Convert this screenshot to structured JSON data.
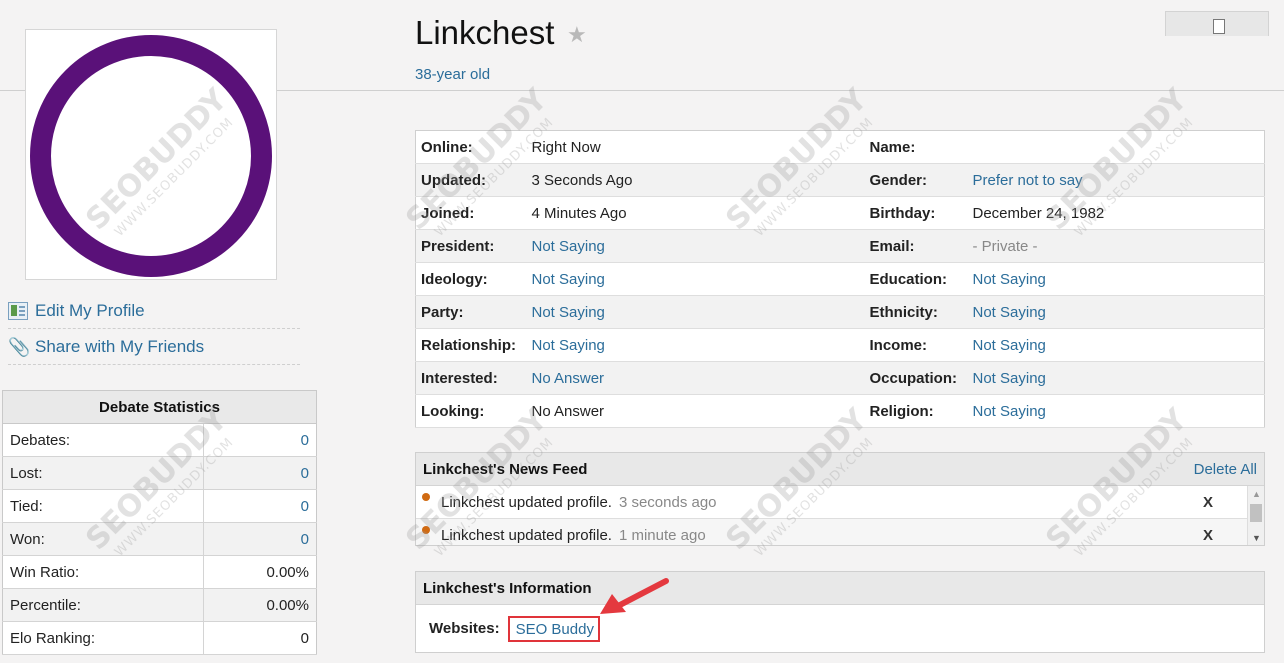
{
  "profile": {
    "username": "Linkchest",
    "age": "38-year old"
  },
  "sidebar": {
    "edit_profile": "Edit My Profile",
    "share": "Share with My Friends"
  },
  "debate_stats": {
    "title": "Debate Statistics",
    "rows": [
      {
        "label": "Debates:",
        "value": "0"
      },
      {
        "label": "Lost:",
        "value": "0"
      },
      {
        "label": "Tied:",
        "value": "0"
      },
      {
        "label": "Won:",
        "value": "0"
      },
      {
        "label": "Win Ratio:",
        "value": "0.00%"
      },
      {
        "label": "Percentile:",
        "value": "0.00%"
      },
      {
        "label": "Elo Ranking:",
        "value": "0"
      }
    ]
  },
  "info": {
    "rows": [
      {
        "l1": "Online:",
        "v1": "Right Now",
        "l2": "Name:",
        "v2": ""
      },
      {
        "l1": "Updated:",
        "v1": "3 Seconds Ago",
        "l2": "Gender:",
        "v2": "Prefer not to say"
      },
      {
        "l1": "Joined:",
        "v1": "4 Minutes Ago",
        "l2": "Birthday:",
        "v2": "December 24, 1982"
      },
      {
        "l1": "President:",
        "v1": "Not Saying",
        "l2": "Email:",
        "v2": "- Private -"
      },
      {
        "l1": "Ideology:",
        "v1": "Not Saying",
        "l2": "Education:",
        "v2": "Not Saying"
      },
      {
        "l1": "Party:",
        "v1": "Not Saying",
        "l2": "Ethnicity:",
        "v2": "Not Saying"
      },
      {
        "l1": "Relationship:",
        "v1": "Not Saying",
        "l2": "Income:",
        "v2": "Not Saying"
      },
      {
        "l1": "Interested:",
        "v1": "No Answer",
        "l2": "Occupation:",
        "v2": "Not Saying"
      },
      {
        "l1": "Looking:",
        "v1": "No Answer",
        "l2": "Religion:",
        "v2": "Not Saying"
      }
    ]
  },
  "news_feed": {
    "title": "Linkchest's News Feed",
    "delete_all": "Delete All",
    "items": [
      {
        "text": "Linkchest updated profile.",
        "time": "3 seconds ago",
        "remove": "X"
      },
      {
        "text": "Linkchest updated profile.",
        "time": "1 minute ago",
        "remove": "X"
      }
    ]
  },
  "information": {
    "title": "Linkchest's Information",
    "websites_label": "Websites:",
    "website": "SEO Buddy"
  },
  "watermark": {
    "brand": "SEOBUDDY",
    "url": "WWW.SEOBUDDY.COM"
  },
  "colors": {
    "link": "#2b6d9a",
    "avatar_ring": "#5a1179",
    "highlight": "#e0343a",
    "feed_dot": "#d06a12"
  }
}
